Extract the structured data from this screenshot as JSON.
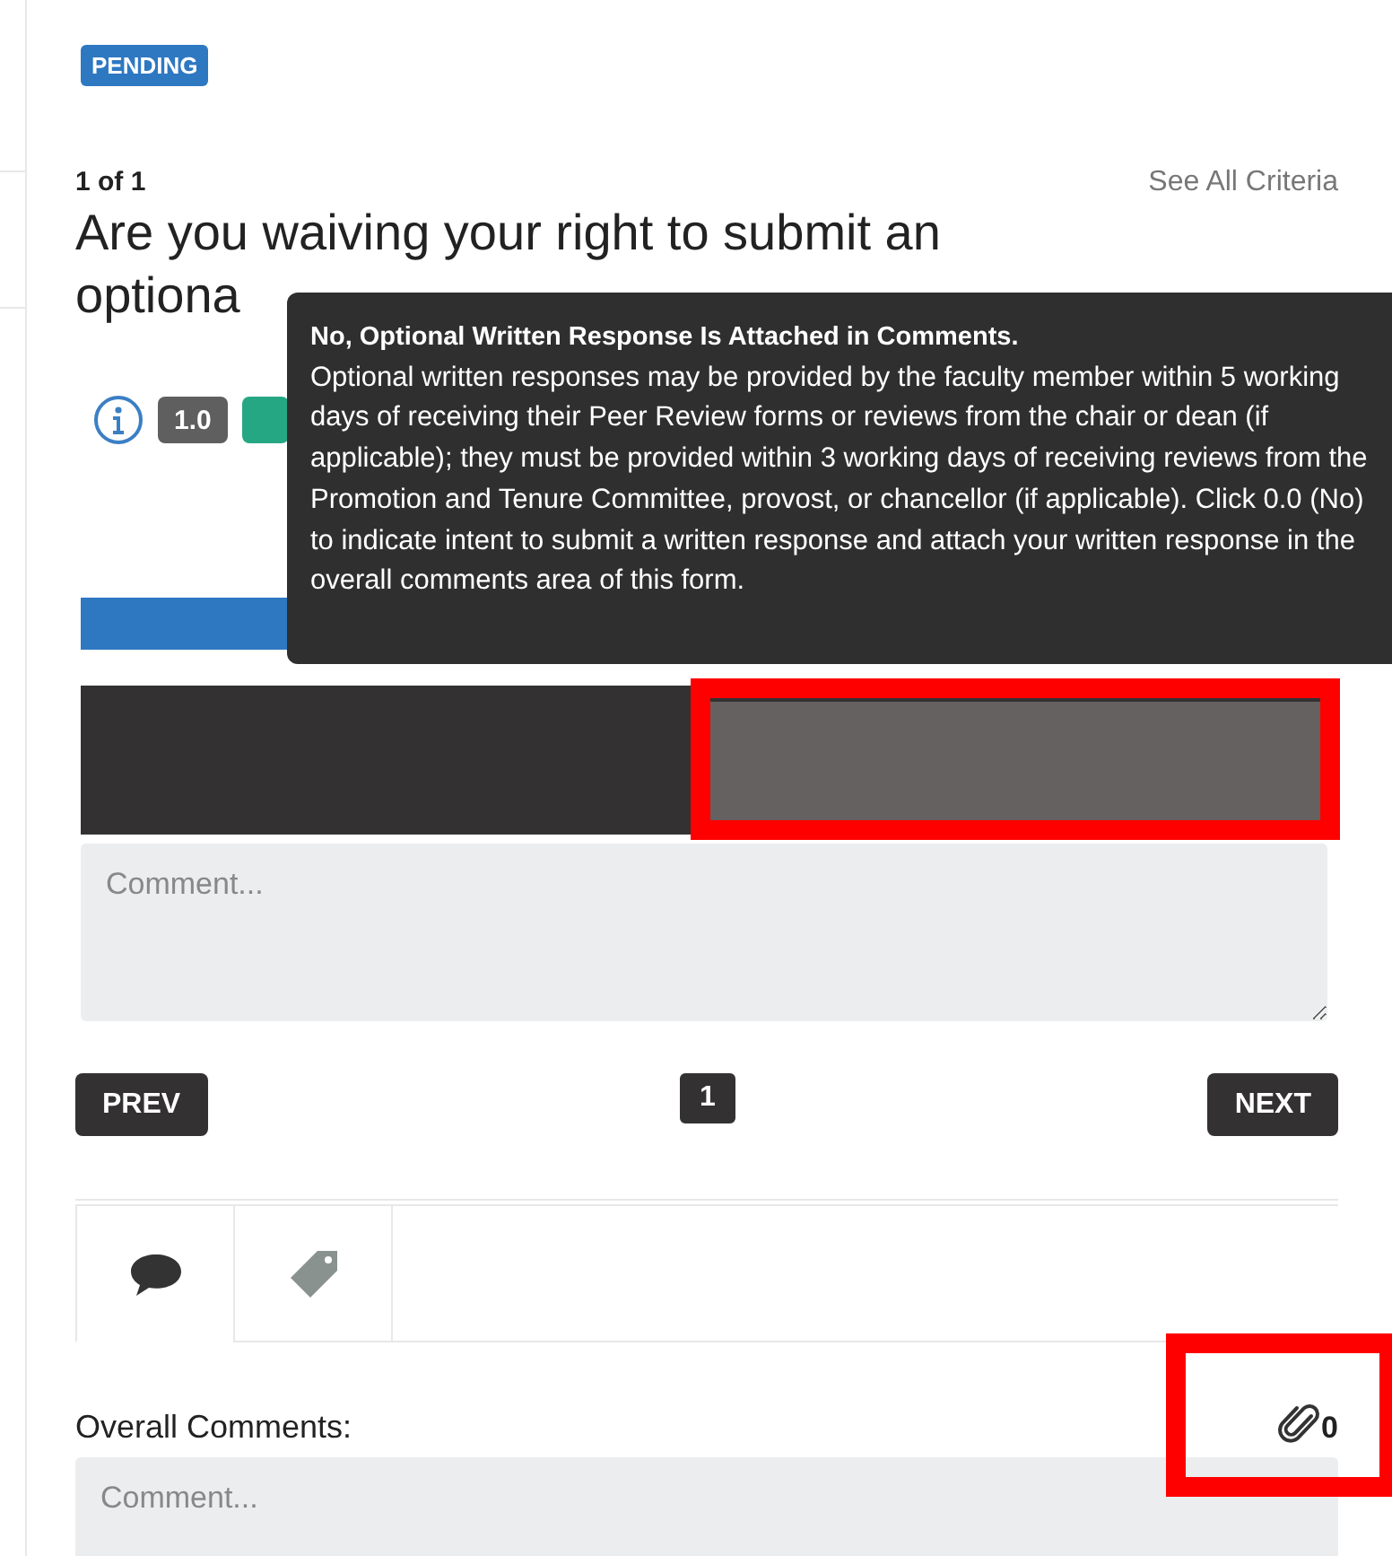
{
  "status_badge": "PENDING",
  "criterion": {
    "position": "1 of 1",
    "see_all_link": "See All Criteria",
    "title_lines": [
      "Are you waiving your right to submit an",
      "optiona"
    ],
    "score_options": [
      {
        "label": "1.0",
        "color": "#5f5f5f"
      },
      {
        "color": "#26a784"
      }
    ]
  },
  "tooltip": {
    "heading": "No, Optional Written Response Is Attached in Comments.",
    "body": "Optional written responses may be provided by the faculty member within 5 working days of receiving their Peer Review forms or reviews from the chair or dean (if applicable); they must be provided within 3 working days of receiving reviews from the Promotion and Tenure Committee, provost, or chancellor (if applicable). Click 0.0 (No) to indicate intent to submit a written response and attach your written response in the overall comments area of this form."
  },
  "comment": {
    "placeholder": "Comment..."
  },
  "pager": {
    "prev": "PREV",
    "pages": [
      {
        "label": "1",
        "selected": true
      }
    ],
    "next": "NEXT"
  },
  "tabs": [
    {
      "kind": "comment",
      "selected": true
    },
    {
      "kind": "tag",
      "selected": false
    }
  ],
  "overall_comments": {
    "label": "Overall Comments:",
    "attachment_count": "0",
    "placeholder": "Comment..."
  }
}
